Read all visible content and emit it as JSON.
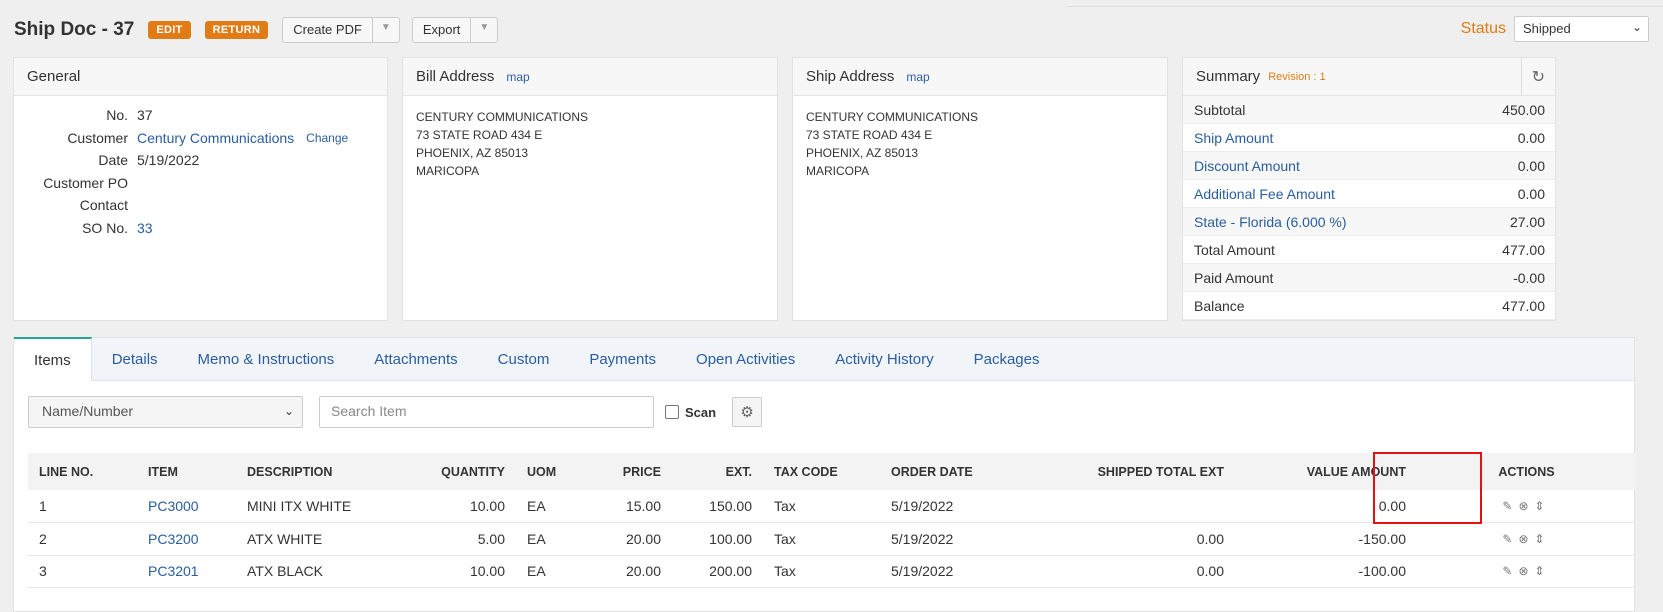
{
  "header": {
    "title": "Ship Doc - 37",
    "edit_label": "EDIT",
    "return_label": "RETURN",
    "create_pdf_label": "Create PDF",
    "export_label": "Export",
    "status_label": "Status",
    "status_value": "Shipped"
  },
  "general": {
    "title": "General",
    "fields": [
      {
        "key": "No.",
        "value": "37"
      },
      {
        "key": "Customer",
        "value": "Century Communications",
        "action": "Change"
      },
      {
        "key": "Date",
        "value": "5/19/2022"
      },
      {
        "key": "Customer PO",
        "value": ""
      },
      {
        "key": "Contact",
        "value": ""
      },
      {
        "key": "SO No.",
        "value": "33"
      }
    ]
  },
  "bill_address": {
    "title": "Bill Address",
    "map_label": "map",
    "lines": [
      "CENTURY COMMUNICATIONS",
      "73 STATE ROAD 434 E",
      "PHOENIX, AZ 85013",
      "MARICOPA"
    ]
  },
  "ship_address": {
    "title": "Ship Address",
    "map_label": "map",
    "lines": [
      "CENTURY COMMUNICATIONS",
      "73 STATE ROAD 434 E",
      "PHOENIX, AZ 85013",
      "MARICOPA"
    ]
  },
  "summary": {
    "title": "Summary",
    "revision": "Revision : 1",
    "rows": [
      {
        "label": "Subtotal",
        "value": "450.00"
      },
      {
        "label": "Ship Amount",
        "value": "0.00"
      },
      {
        "label": "Discount Amount",
        "value": "0.00"
      },
      {
        "label": "Additional Fee Amount",
        "value": "0.00"
      },
      {
        "label": "State - Florida (6.000 %)",
        "value": "27.00"
      },
      {
        "label": "Total Amount",
        "value": "477.00"
      },
      {
        "label": "Paid Amount",
        "value": "-0.00"
      },
      {
        "label": "Balance",
        "value": "477.00"
      }
    ]
  },
  "tabs": [
    "Items",
    "Details",
    "Memo & Instructions",
    "Attachments",
    "Custom",
    "Payments",
    "Open Activities",
    "Activity History",
    "Packages"
  ],
  "filters": {
    "select_value": "Name/Number",
    "search_placeholder": "Search Item",
    "scan_label": "Scan"
  },
  "table": {
    "headers": [
      "LINE NO.",
      "ITEM",
      "DESCRIPTION",
      "QUANTITY",
      "UOM",
      "PRICE",
      "EXT.",
      "TAX CODE",
      "ORDER DATE",
      "SHIPPED TOTAL EXT",
      "VALUE AMOUNT",
      "ACTIONS"
    ],
    "rows": [
      {
        "line": "1",
        "item": "PC3000",
        "description": "MINI ITX WHITE",
        "quantity": "10.00",
        "uom": "EA",
        "price": "15.00",
        "ext": "150.00",
        "tax": "Tax",
        "date": "5/19/2022",
        "shipped": "",
        "value": "0.00"
      },
      {
        "line": "2",
        "item": "PC3200",
        "description": "ATX WHITE",
        "quantity": "5.00",
        "uom": "EA",
        "price": "20.00",
        "ext": "100.00",
        "tax": "Tax",
        "date": "5/19/2022",
        "shipped": "0.00",
        "value": "-150.00"
      },
      {
        "line": "3",
        "item": "PC3201",
        "description": "ATX BLACK",
        "quantity": "10.00",
        "uom": "EA",
        "price": "20.00",
        "ext": "200.00",
        "tax": "Tax",
        "date": "5/19/2022",
        "shipped": "0.00",
        "value": "-100.00"
      }
    ]
  }
}
